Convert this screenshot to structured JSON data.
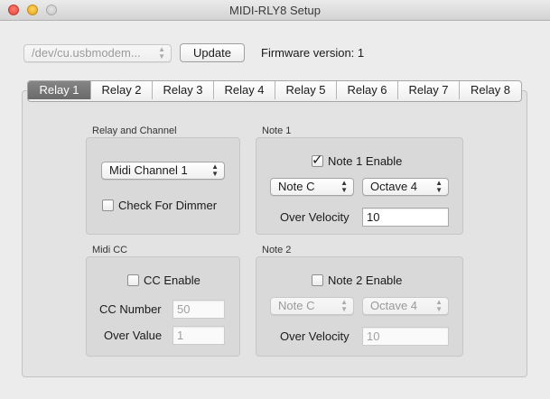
{
  "window": {
    "title": "MIDI-RLY8 Setup"
  },
  "toolbar": {
    "port_value": "/dev/cu.usbmodem...",
    "update_label": "Update",
    "firmware_text": "Firmware version: 1"
  },
  "tabs": [
    {
      "label": "Relay 1",
      "active": true
    },
    {
      "label": "Relay 2"
    },
    {
      "label": "Relay 3"
    },
    {
      "label": "Relay 4"
    },
    {
      "label": "Relay 5"
    },
    {
      "label": "Relay 6"
    },
    {
      "label": "Relay 7"
    },
    {
      "label": "Relay 8"
    }
  ],
  "relay_channel": {
    "title": "Relay and Channel",
    "channel_value": "Midi Channel 1",
    "dimmer_label": "Check For Dimmer",
    "dimmer_checked": false
  },
  "note1": {
    "title": "Note 1",
    "enable_label": "Note 1 Enable",
    "enable_checked": true,
    "note_value": "Note C",
    "octave_value": "Octave 4",
    "velocity_label": "Over Velocity",
    "velocity_value": "10"
  },
  "midi_cc": {
    "title": "Midi CC",
    "enable_label": "CC Enable",
    "enable_checked": false,
    "number_label": "CC Number",
    "number_value": "50",
    "value_label": "Over Value",
    "value_value": "1"
  },
  "note2": {
    "title": "Note 2",
    "enable_label": "Note 2 Enable",
    "enable_checked": false,
    "note_value": "Note C",
    "octave_value": "Octave 4",
    "velocity_label": "Over Velocity",
    "velocity_value": "10"
  }
}
